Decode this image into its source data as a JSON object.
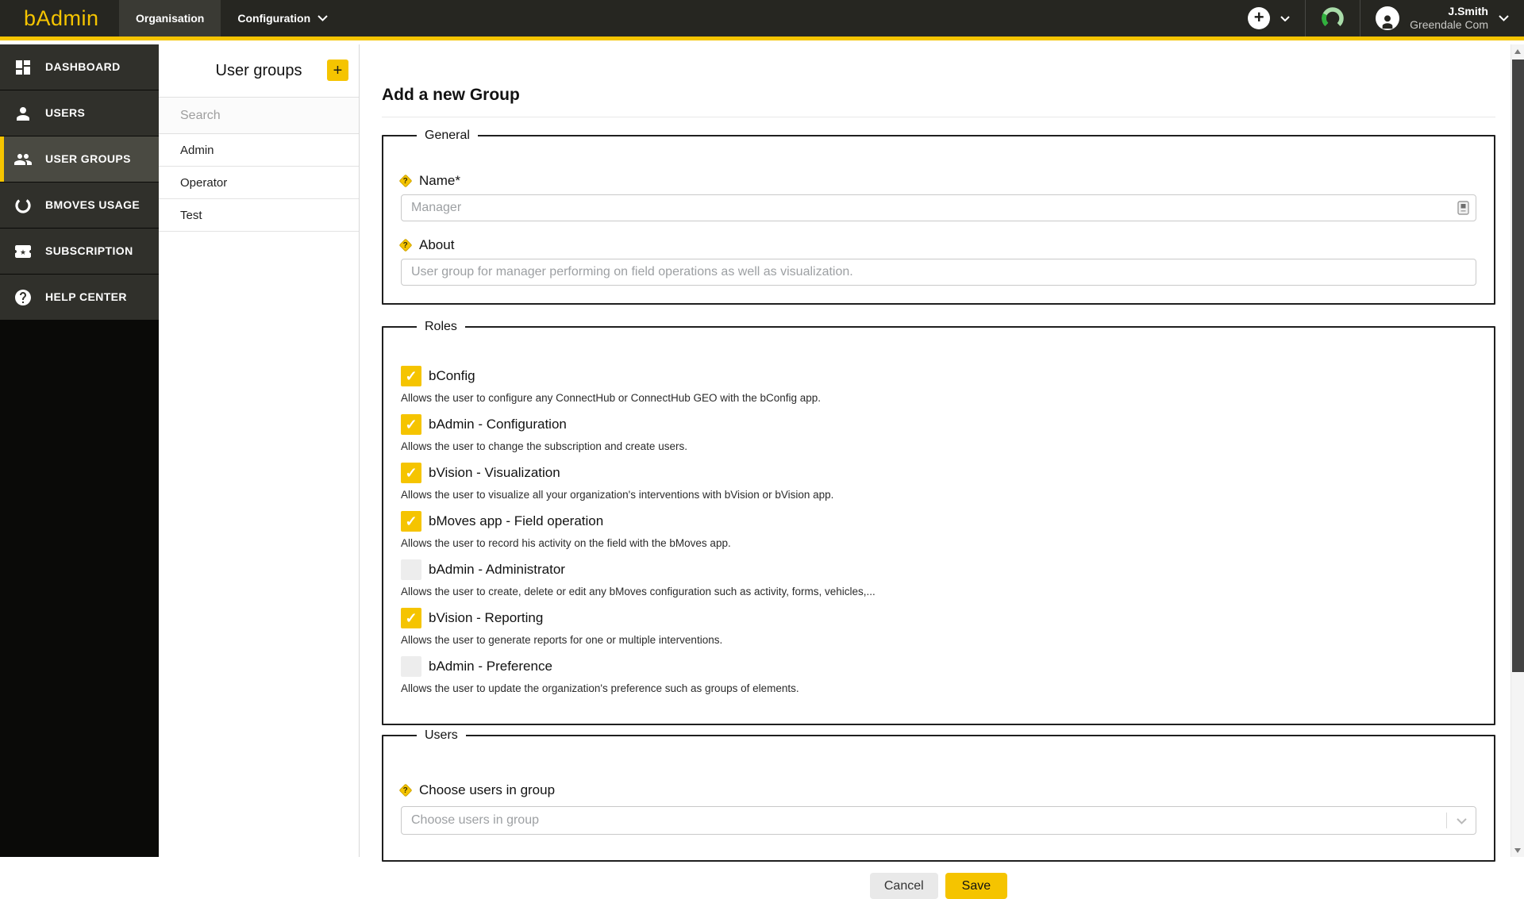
{
  "topbar": {
    "logo": "bAdmin",
    "menu": [
      {
        "label": "Organisation",
        "active": true
      },
      {
        "label": "Configuration",
        "active": false
      }
    ],
    "user": {
      "name": "J.Smith",
      "org": "Greendale Com"
    }
  },
  "sidebar": {
    "items": [
      {
        "label": "DASHBOARD",
        "icon": "dashboard-icon",
        "active": false
      },
      {
        "label": "USERS",
        "icon": "user-icon",
        "active": false
      },
      {
        "label": "USER GROUPS",
        "icon": "user-groups-icon",
        "active": true
      },
      {
        "label": "BMOVES USAGE",
        "icon": "usage-ring-icon",
        "active": false
      },
      {
        "label": "SUBSCRIPTION",
        "icon": "ticket-star-icon",
        "active": false
      },
      {
        "label": "HELP CENTER",
        "icon": "help-circle-icon",
        "active": false
      }
    ]
  },
  "list_panel": {
    "title": "User groups",
    "add_button": "+",
    "search_placeholder": "Search",
    "items": [
      "Admin",
      "Operator",
      "Test"
    ]
  },
  "form": {
    "title": "Add a new Group",
    "general": {
      "legend": "General",
      "name_label": "Name*",
      "name_placeholder": "Manager",
      "about_label": "About",
      "about_placeholder": "User group for manager performing on field operations as well as visualization."
    },
    "roles": {
      "legend": "Roles",
      "items": [
        {
          "label": "bConfig",
          "checked": true,
          "description": "Allows the user to configure any ConnectHub or ConnectHub GEO with the bConfig app."
        },
        {
          "label": "bAdmin - Configuration",
          "checked": true,
          "description": "Allows the user to change the subscription and create users."
        },
        {
          "label": "bVision - Visualization",
          "checked": true,
          "description": "Allows the user to visualize all your organization's interventions with bVision or bVision app."
        },
        {
          "label": "bMoves app - Field operation",
          "checked": true,
          "description": "Allows the user to record his activity on the field with the bMoves app."
        },
        {
          "label": "bAdmin - Administrator",
          "checked": false,
          "description": "Allows the user to create, delete or edit any bMoves configuration such as activity, forms, vehicles,..."
        },
        {
          "label": "bVision - Reporting",
          "checked": true,
          "description": "Allows the user to generate reports for one or multiple interventions."
        },
        {
          "label": "bAdmin - Preference",
          "checked": false,
          "description": "Allows the user to update the organization's preference such as groups of elements."
        }
      ]
    },
    "users": {
      "legend": "Users",
      "label": "Choose users in group",
      "select_placeholder": "Choose users in group"
    },
    "actions": {
      "cancel": "Cancel",
      "save": "Save"
    }
  },
  "colors": {
    "accent_yellow": "#F5C400",
    "topbar_bg": "#262621",
    "sidebar_item_bg": "#30302B",
    "sidebar_active_bg": "#4A4A42",
    "gauge_light_green": "#A9DCA9",
    "gauge_dark_green": "#2FB13C"
  }
}
